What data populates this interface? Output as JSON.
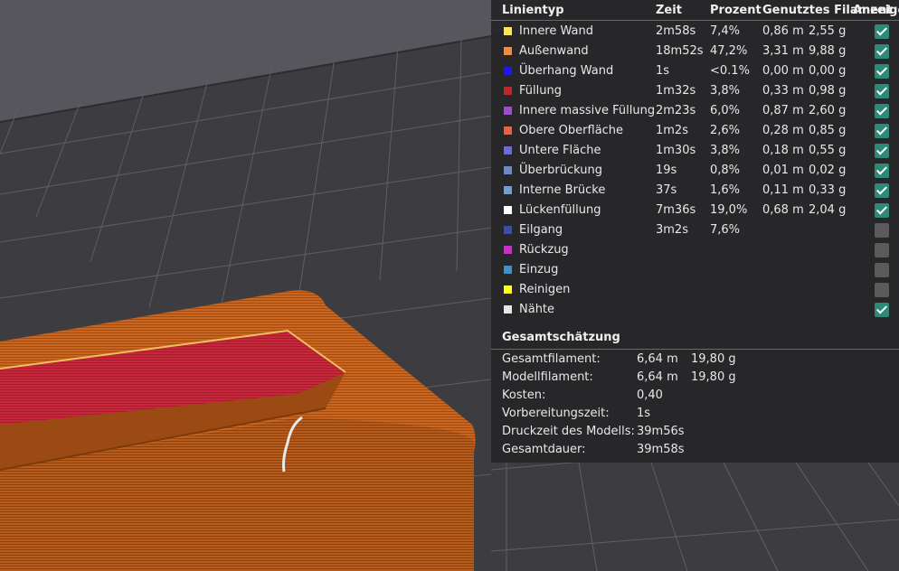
{
  "columns": {
    "type": "Linientyp",
    "time": "Zeit",
    "percent": "Prozent",
    "filament": "Genutztes Filament",
    "display": "Anzeige"
  },
  "rows": [
    {
      "name": "Innere Wand",
      "color": "#ffe84d",
      "time": "2m58s",
      "percent": "7,4%",
      "length": "0,86 m",
      "weight": "2,55 g",
      "checked": true
    },
    {
      "name": "Außenwand",
      "color": "#ef8d3c",
      "time": "18m52s",
      "percent": "47,2%",
      "length": "3,31 m",
      "weight": "9,88 g",
      "checked": true
    },
    {
      "name": "Überhang Wand",
      "color": "#1a1af0",
      "time": "1s",
      "percent": "<0.1%",
      "length": "0,00 m",
      "weight": "0,00 g",
      "checked": true
    },
    {
      "name": "Füllung",
      "color": "#c0272b",
      "time": "1m32s",
      "percent": "3,8%",
      "length": "0,33 m",
      "weight": "0,98 g",
      "checked": true
    },
    {
      "name": "Innere massive Füllung",
      "color": "#9a4fcf",
      "time": "2m23s",
      "percent": "6,0%",
      "length": "0,87 m",
      "weight": "2,60 g",
      "checked": true
    },
    {
      "name": "Obere Oberfläche",
      "color": "#e8623f",
      "time": "1m2s",
      "percent": "2,6%",
      "length": "0,28 m",
      "weight": "0,85 g",
      "checked": true
    },
    {
      "name": "Untere Fläche",
      "color": "#6b6bd9",
      "time": "1m30s",
      "percent": "3,8%",
      "length": "0,18 m",
      "weight": "0,55 g",
      "checked": true
    },
    {
      "name": "Überbrückung",
      "color": "#6f86c9",
      "time": "19s",
      "percent": "0,8%",
      "length": "0,01 m",
      "weight": "0,02 g",
      "checked": true
    },
    {
      "name": "Interne Brücke",
      "color": "#6f9fcf",
      "time": "37s",
      "percent": "1,6%",
      "length": "0,11 m",
      "weight": "0,33 g",
      "checked": true
    },
    {
      "name": "Lückenfüllung",
      "color": "#ffffff",
      "time": "7m36s",
      "percent": "19,0%",
      "length": "0,68 m",
      "weight": "2,04 g",
      "checked": true
    },
    {
      "name": "Eilgang",
      "color": "#3a4fa8",
      "time": "3m2s",
      "percent": "7,6%",
      "length": "",
      "weight": "",
      "checked": false
    },
    {
      "name": "Rückzug",
      "color": "#cc2ccc",
      "time": "",
      "percent": "",
      "length": "",
      "weight": "",
      "checked": false
    },
    {
      "name": "Einzug",
      "color": "#3f92c9",
      "time": "",
      "percent": "",
      "length": "",
      "weight": "",
      "checked": false
    },
    {
      "name": "Reinigen",
      "color": "#ffff1a",
      "time": "",
      "percent": "",
      "length": "",
      "weight": "",
      "checked": false
    },
    {
      "name": "Nähte",
      "color": "#e6e6e6",
      "time": "",
      "percent": "",
      "length": "",
      "weight": "",
      "checked": true
    }
  ],
  "summary": {
    "title": "Gesamtschätzung",
    "rows": [
      {
        "label": "Gesamtfilament:",
        "v1": "6,64 m",
        "v2": "19,80 g"
      },
      {
        "label": "Modellfilament:",
        "v1": "6,64 m",
        "v2": "19,80 g"
      },
      {
        "label": "Kosten:",
        "v1": "0,40",
        "v2": ""
      },
      {
        "label": "Vorbereitungszeit:",
        "v1": "1s",
        "v2": ""
      },
      {
        "label": "Druckzeit des Modells:",
        "v1": "39m56s",
        "v2": ""
      },
      {
        "label": "Gesamtdauer:",
        "v1": "39m58s",
        "v2": ""
      }
    ]
  }
}
